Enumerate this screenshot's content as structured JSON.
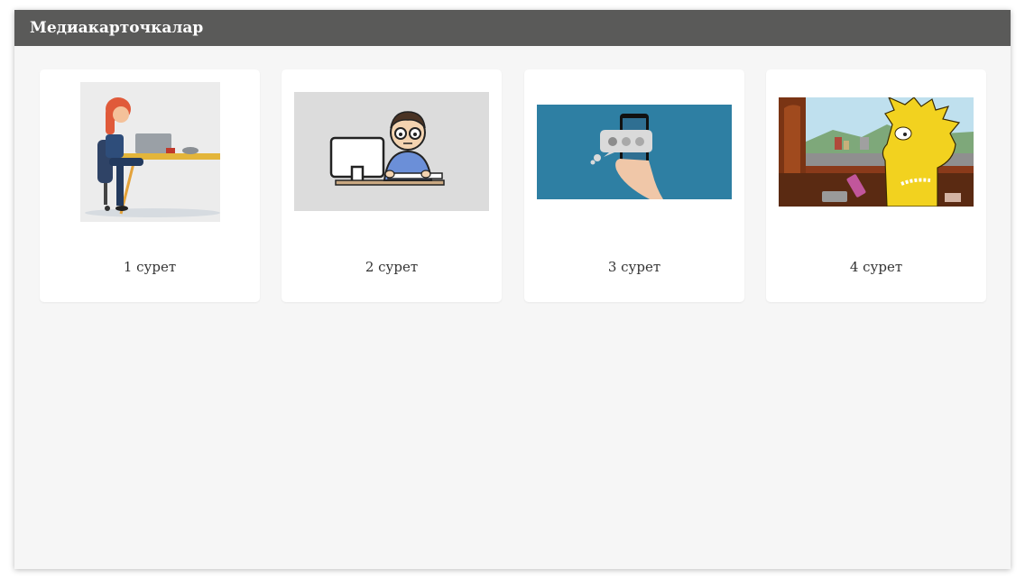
{
  "header": {
    "title": "Медиакарточкалар"
  },
  "cards": [
    {
      "caption": "1 сурет",
      "image": "woman-at-laptop-desk-illustration"
    },
    {
      "caption": "2 сурет",
      "image": "man-at-computer-illustration"
    },
    {
      "caption": "3 сурет",
      "image": "hand-holding-phone-chat-bubble-illustration"
    },
    {
      "caption": "4 сурет",
      "image": "cartoon-girl-with-phone-in-car-frame"
    }
  ],
  "colors": {
    "header_bg": "#5a5a59",
    "panel_bg": "#f6f6f6",
    "card_bg": "#ffffff",
    "thumb3_bg": "#2e7fa3"
  }
}
